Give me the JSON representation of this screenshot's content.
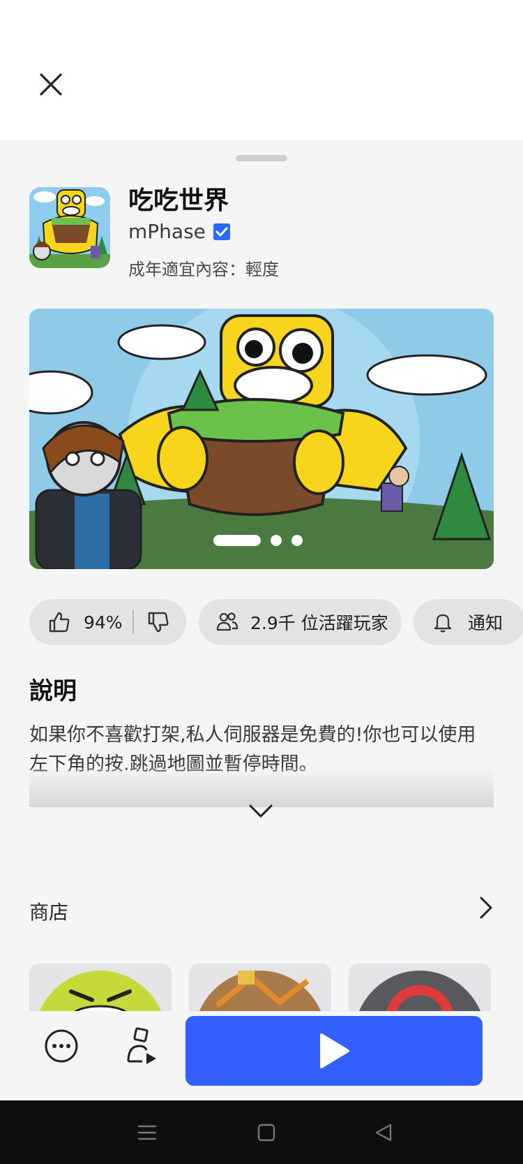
{
  "header": {
    "close_icon": "close-icon"
  },
  "game": {
    "title": "吃吃世界",
    "developer": "mPhase",
    "verified_icon": "verified-badge-icon",
    "content_rating": "成年適宜內容：輕度"
  },
  "carousel": {
    "page_count": 3,
    "active_index": 0
  },
  "stats": {
    "approval": "94%",
    "players": "2.9千 位活躍玩家",
    "notify": "通知"
  },
  "description": {
    "heading": "說明",
    "text": "如果你不喜歡打架,私人伺服器是免費的!你也可以使用左下角的按.跳過地圖並暫停時間。"
  },
  "store": {
    "heading": "商店"
  },
  "colors": {
    "accent": "#335fff",
    "verified": "#2a6bff"
  }
}
